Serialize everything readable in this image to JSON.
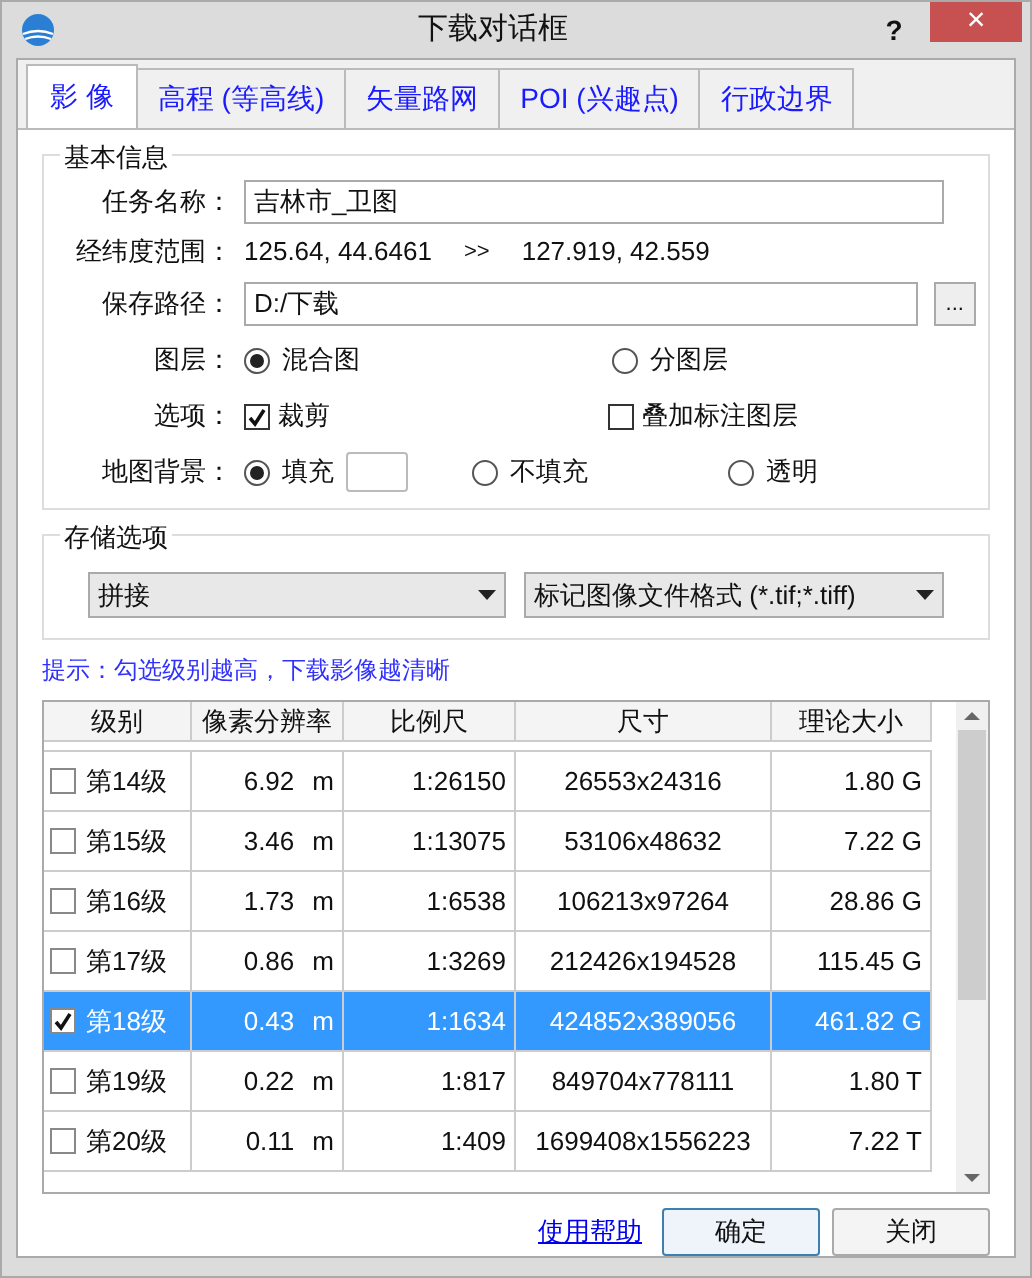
{
  "window": {
    "title": "下载对话框",
    "help": "?",
    "close": "×"
  },
  "tabs": [
    {
      "label": "影 像",
      "selected": true
    },
    {
      "label": "高程 (等高线)",
      "selected": false
    },
    {
      "label": "矢量路网",
      "selected": false
    },
    {
      "label": "POI (兴趣点)",
      "selected": false
    },
    {
      "label": "行政边界",
      "selected": false
    }
  ],
  "basic_info": {
    "title": "基本信息",
    "task_name": {
      "label": "任务名称：",
      "value": "吉林市_卫图"
    },
    "range": {
      "label": "经纬度范围：",
      "from": "125.64, 44.6461",
      "arrow": ">>",
      "to": "127.919, 42.559"
    },
    "save_path": {
      "label": "保存路径：",
      "value": "D:/下载",
      "browse": "..."
    },
    "layers": {
      "label": "图层：",
      "options": [
        {
          "label": "混合图",
          "selected": true
        },
        {
          "label": "分图层",
          "selected": false
        }
      ]
    },
    "options": {
      "label": "选项：",
      "items": [
        {
          "label": "裁剪",
          "checked": true
        },
        {
          "label": "叠加标注图层",
          "checked": false
        }
      ]
    },
    "background": {
      "label": "地图背景：",
      "options": [
        {
          "label": "填充",
          "selected": true,
          "color": "#ffffff"
        },
        {
          "label": "不填充",
          "selected": false
        },
        {
          "label": "透明",
          "selected": false
        }
      ]
    }
  },
  "storage": {
    "title": "存储选项",
    "mode": "拼接",
    "format": "标记图像文件格式 (*.tif;*.tiff)"
  },
  "hint": "提示：勾选级别越高，下载影像越清晰",
  "table": {
    "columns": [
      "级别",
      "像素分辨率",
      "比例尺",
      "尺寸",
      "理论大小"
    ],
    "rows": [
      {
        "level": "第14级",
        "checked": false,
        "selected": false,
        "resolution": "6.92",
        "unit": "m",
        "scale": "1:26150",
        "size": "26553x24316",
        "theoretical": "1.80 G"
      },
      {
        "level": "第15级",
        "checked": false,
        "selected": false,
        "resolution": "3.46",
        "unit": "m",
        "scale": "1:13075",
        "size": "53106x48632",
        "theoretical": "7.22 G"
      },
      {
        "level": "第16级",
        "checked": false,
        "selected": false,
        "resolution": "1.73",
        "unit": "m",
        "scale": "1:6538",
        "size": "106213x97264",
        "theoretical": "28.86 G"
      },
      {
        "level": "第17级",
        "checked": false,
        "selected": false,
        "resolution": "0.86",
        "unit": "m",
        "scale": "1:3269",
        "size": "212426x194528",
        "theoretical": "115.45 G"
      },
      {
        "level": "第18级",
        "checked": true,
        "selected": true,
        "resolution": "0.43",
        "unit": "m",
        "scale": "1:1634",
        "size": "424852x389056",
        "theoretical": "461.82 G"
      },
      {
        "level": "第19级",
        "checked": false,
        "selected": false,
        "resolution": "0.22",
        "unit": "m",
        "scale": "1:817",
        "size": "849704x778111",
        "theoretical": "1.80 T"
      },
      {
        "level": "第20级",
        "checked": false,
        "selected": false,
        "resolution": "0.11",
        "unit": "m",
        "scale": "1:409",
        "size": "1699408x1556223",
        "theoretical": "7.22 T"
      }
    ]
  },
  "footer": {
    "help_link": "使用帮助",
    "buttons": [
      "确定",
      "关闭"
    ]
  }
}
